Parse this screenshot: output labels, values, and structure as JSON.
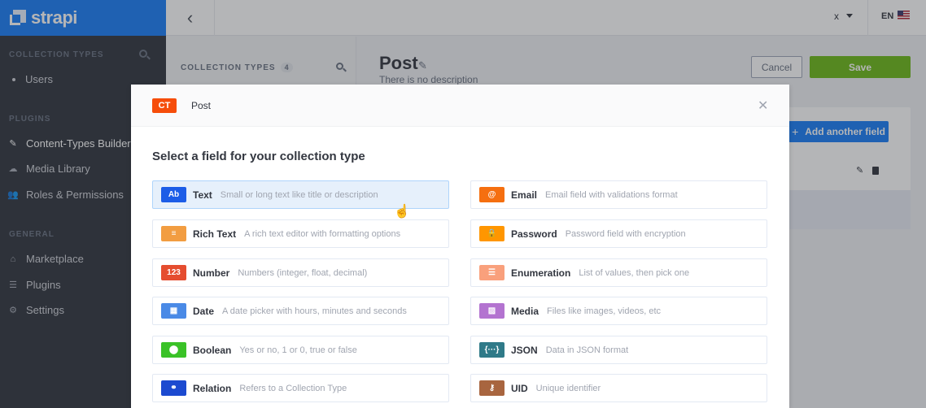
{
  "brand": {
    "name": "strapi"
  },
  "sidebar": {
    "collection_types_title": "COLLECTION TYPES",
    "collection_items": [
      {
        "label": "Users"
      }
    ],
    "plugins_title": "PLUGINS",
    "plugin_items": [
      {
        "label": "Content-Types Builder",
        "icon": "brush-icon"
      },
      {
        "label": "Media Library",
        "icon": "cloud-icon"
      },
      {
        "label": "Roles & Permissions",
        "icon": "users-icon"
      }
    ],
    "general_title": "GENERAL",
    "general_items": [
      {
        "label": "Marketplace",
        "icon": "shop-icon"
      },
      {
        "label": "Plugins",
        "icon": "list-icon"
      },
      {
        "label": "Settings",
        "icon": "gear-icon"
      }
    ]
  },
  "header": {
    "user": "x",
    "language": "EN"
  },
  "collection_list": {
    "title": "COLLECTION TYPES",
    "count": "4"
  },
  "main": {
    "title": "Post",
    "description": "There is no description",
    "cancel_label": "Cancel",
    "save_label": "Save",
    "add_field_label": "Add another field"
  },
  "modal": {
    "badge": "CT",
    "name": "Post",
    "heading": "Select a field for your collection type",
    "fields": [
      {
        "name": "Text",
        "desc": "Small or long text like title or description",
        "icon_text": "Ab",
        "color": "#1c5de7"
      },
      {
        "name": "Email",
        "desc": "Email field with validations format",
        "icon_text": "@",
        "color": "#f56f10"
      },
      {
        "name": "Rich Text",
        "desc": "A rich text editor with formatting options",
        "icon_text": "≡",
        "color": "#f29d41"
      },
      {
        "name": "Password",
        "desc": "Password field with encryption",
        "icon_text": "🔒",
        "color": "#ff9600"
      },
      {
        "name": "Number",
        "desc": "Numbers (integer, float, decimal)",
        "icon_text": "123",
        "color": "#e54d2f"
      },
      {
        "name": "Enumeration",
        "desc": "List of values, then pick one",
        "icon_text": "☰",
        "color": "#f9a07c"
      },
      {
        "name": "Date",
        "desc": "A date picker with hours, minutes and seconds",
        "icon_text": "▦",
        "color": "#4a8ae6"
      },
      {
        "name": "Media",
        "desc": "Files like images, videos, etc",
        "icon_text": "▨",
        "color": "#b373d0"
      },
      {
        "name": "Boolean",
        "desc": "Yes or no, 1 or 0, true or false",
        "icon_text": "⬤",
        "color": "#3ac227"
      },
      {
        "name": "JSON",
        "desc": "Data in JSON format",
        "icon_text": "{···}",
        "color": "#2f7a88"
      },
      {
        "name": "Relation",
        "desc": "Refers to a Collection Type",
        "icon_text": "⚭",
        "color": "#1c4ad0"
      },
      {
        "name": "UID",
        "desc": "Unique identifier",
        "icon_text": "⚷",
        "color": "#a8653f"
      }
    ]
  }
}
